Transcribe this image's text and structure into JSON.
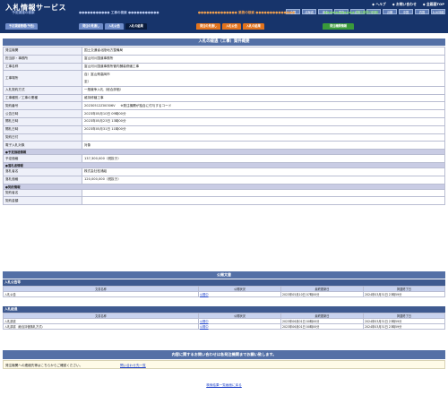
{
  "header": {
    "logo": "入札情報サービス",
    "toplinks": [
      "ヘルプ",
      "お問い合わせ",
      "全画面TOP"
    ],
    "regions": [
      "全国",
      "北海道",
      "東北",
      "関東",
      "北陸",
      "中部",
      "近畿",
      "中国",
      "四国",
      "九州沖縄"
    ],
    "cat_left_title": "予定調達の検索",
    "cat_proc_title": "工事の検索",
    "cat_svc_title": "業務の検索",
    "cat_order_title": "発注機関の検索",
    "tabs_left": [
      "予定調達管理(予告)"
    ],
    "tabs_proc": [
      "発注の見通し",
      "入札公告",
      "入札の結果"
    ],
    "tabs_svc": [
      "発注の見通し",
      "入札公告",
      "入札の結果"
    ],
    "tabs_order": [
      "発注機関情報"
    ],
    "colors": {
      "navy": "#17346b",
      "blue": "#6f8cc9",
      "orange": "#e2731d",
      "green": "#3a9a3a",
      "panel": "#5470a6"
    }
  },
  "detail": {
    "title": "入札の経過（工事）案件概要",
    "rows": [
      {
        "label": "発注機関",
        "value": "国土交通省北陸地方整備局"
      },
      {
        "label": "担当部・事務所",
        "value": "富山河川国道事務所"
      },
      {
        "label": "工事名称",
        "value": "富山河川国道事務所管内舗装修繕工事"
      },
      {
        "label": "工事場所",
        "value_lines": [
          "自）富山県高岡市",
          "至）"
        ]
      },
      {
        "label": "入札契約方式",
        "value": "一般競争入札（総合評価）"
      },
      {
        "label": "工事種別／工事の業種",
        "value": "維持修繕工事"
      },
      {
        "label": "契約番号",
        "value": "20230512Z00306V",
        "note": "※発注機関が独自に付与するコード"
      },
      {
        "label": "公告日時",
        "value": "2023年05月10日 09時00分"
      },
      {
        "label": "開札日時",
        "value": "2023年05月23日 13時00分"
      },
      {
        "label": "開札日時",
        "value": "2023年05月31日 11時00分"
      },
      {
        "label": "契約日付",
        "value": ""
      },
      {
        "label": "電子入札対象",
        "value": "対象"
      }
    ],
    "sec_estimate": "●予定価格情報",
    "estimate_label": "予定価格",
    "estimate_value": "137,300,000（税抜き）",
    "sec_winner": "●落札者情報",
    "winner_rows": [
      {
        "label": "落札者名",
        "value": "株式会社松浦組"
      },
      {
        "label": "落札価格",
        "value": "120,000,000（税抜き）"
      }
    ],
    "sec_contract": "●契約情報",
    "contract_rows": [
      {
        "label": "契約者名",
        "value": ""
      },
      {
        "label": "契約金額",
        "value": ""
      }
    ]
  },
  "attachments": {
    "title": "公開文書",
    "col_headers": [
      "文書名称",
      "公開状況",
      "最終更新日",
      "掲載終了日"
    ],
    "announce": {
      "title": "入札公告等",
      "rows": [
        {
          "name": "入札公告",
          "status": "公開中",
          "updated": "2023年05月10日 07時00分",
          "end": "2024年03月31日 23時59分"
        }
      ]
    },
    "progress": {
      "title": "入札経過",
      "rows": [
        {
          "name": "入札調書",
          "status": "公開中",
          "updated": "2023年06月01日 00時00分",
          "end": "2024年03月31日 23時59分"
        },
        {
          "name": "入札調書（総合評価落札方式）",
          "status": "公開中",
          "updated": "2023年06月01日 00時00分",
          "end": "2024年03月31日 23時59分"
        }
      ]
    }
  },
  "footer": {
    "contact_title": "内容に関するお問い合わせは各発注機関までお願い致します。",
    "contact_text": "発注機関への連絡先等はこちらからご確認ください。",
    "contact_link": "問い合わせ先一覧",
    "back_link": "検索結果一覧画面に戻る"
  }
}
